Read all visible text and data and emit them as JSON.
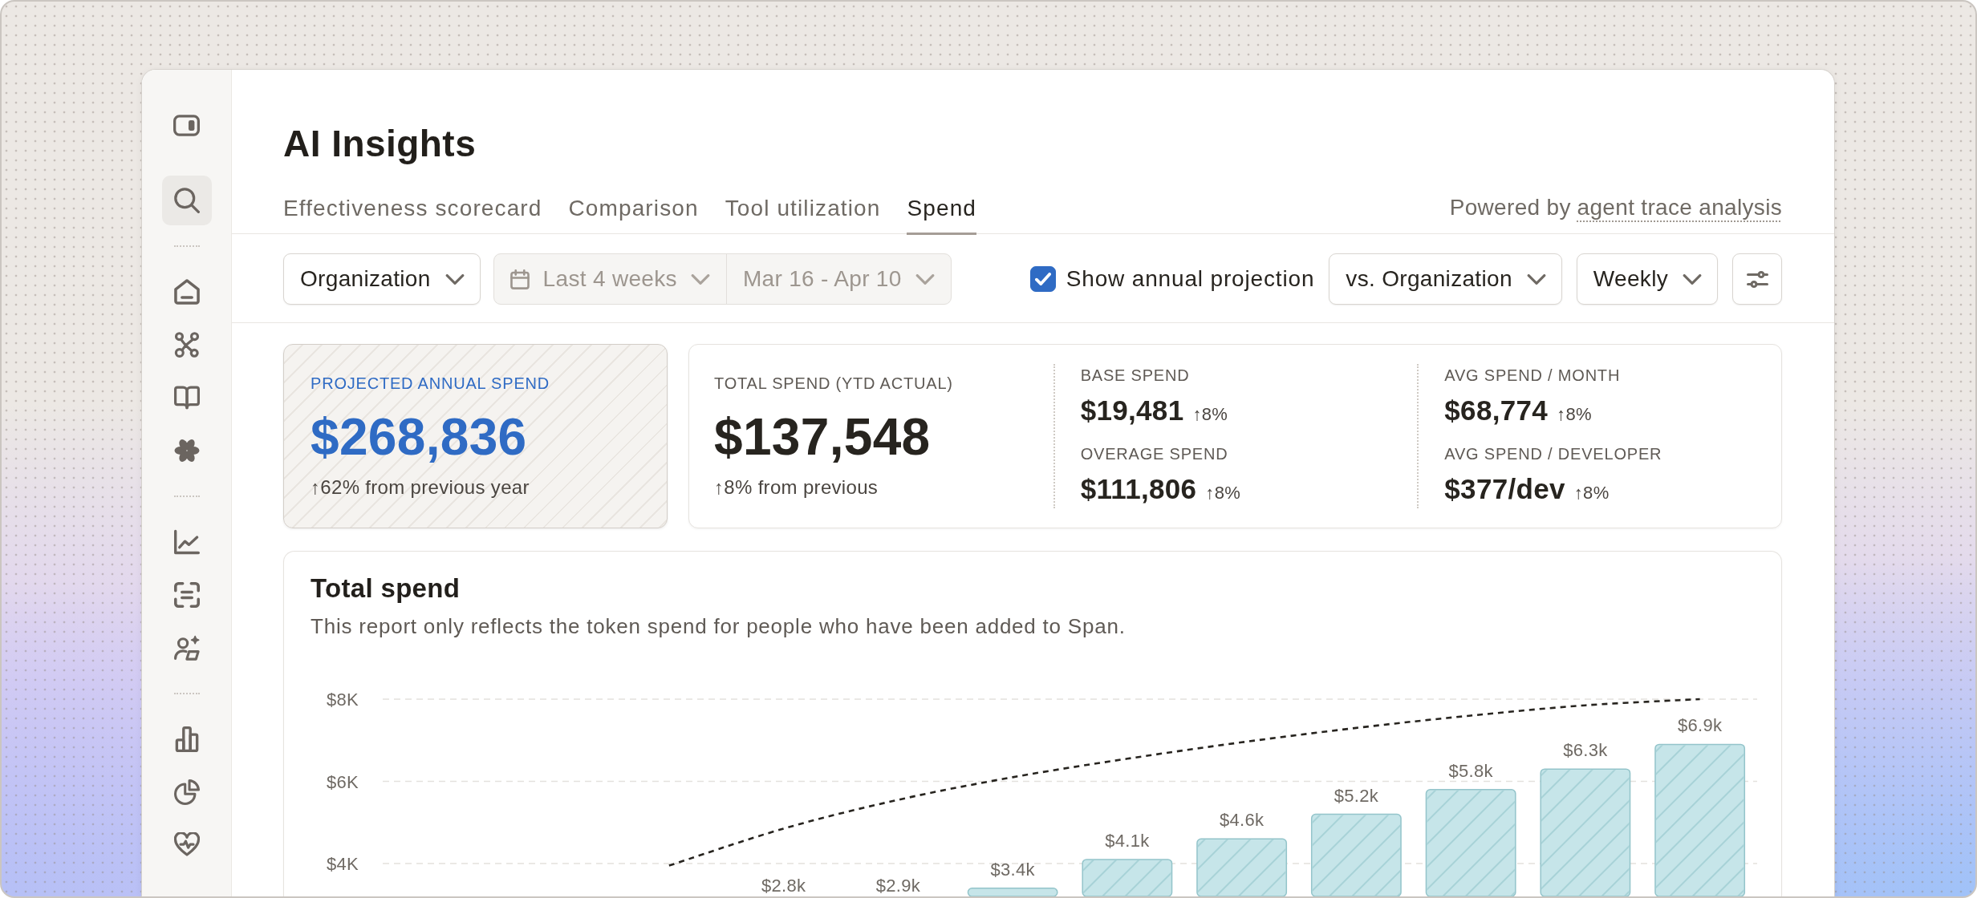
{
  "sidebar": {
    "groups": [
      {
        "items": [
          {
            "selected": true
          }
        ]
      },
      {
        "items": [
          {
            "selected": false
          },
          {
            "selected": false
          },
          {
            "selected": false
          },
          {
            "selected": false
          }
        ]
      },
      {
        "items": [
          {
            "selected": false
          },
          {
            "selected": false
          },
          {
            "selected": false
          }
        ]
      },
      {
        "items": [
          {
            "selected": false
          },
          {
            "selected": false
          },
          {
            "selected": false
          }
        ]
      }
    ]
  },
  "header": {
    "title": "AI Insights",
    "tabs": [
      {
        "label": "Effectiveness scorecard",
        "selected": false
      },
      {
        "label": "Comparison",
        "selected": false
      },
      {
        "label": "Tool utilization",
        "selected": false
      },
      {
        "label": "Spend",
        "selected": true
      }
    ],
    "powered_by": {
      "text": "Powered by",
      "link": "agent trace analysis"
    }
  },
  "toolbar": {
    "scope": {
      "value": "Organization"
    },
    "date_range": {
      "disabled": true,
      "period": "Last 4 weeks",
      "dates": "Mar 16 - Apr 10"
    },
    "projection_toggle": {
      "label": "Show annual projection",
      "checked": true
    },
    "comparison": {
      "value": "vs. Organization"
    },
    "interval": {
      "value": "Weekly"
    }
  },
  "projection_card": {
    "label": "PROJECTED ANNUAL SPEND",
    "value": "$268,836",
    "change": "↑62% from previous year"
  },
  "summary_card": {
    "total": {
      "label": "TOTAL SPEND (YTD ACTUAL)",
      "value": "$137,548",
      "change": "↑8% from previous"
    },
    "metric_columns": [
      {
        "metrics": [
          {
            "label": "BASE SPEND",
            "value": "$19,481",
            "change": "↑8%"
          },
          {
            "label": "OVERAGE SPEND",
            "value": "$111,806",
            "change": "↑8%"
          }
        ]
      },
      {
        "metrics": [
          {
            "label": "AVG SPEND / MONTH",
            "value": "$68,774",
            "change": "↑8%"
          },
          {
            "label": "AVG SPEND / DEVELOPER",
            "value": "$377/dev",
            "change": "↑8%"
          }
        ]
      }
    ]
  },
  "chart_card": {
    "title": "Total spend",
    "subtitle": "This report only reflects the token spend for people who have been added to Span.",
    "chart_data": {
      "type": "bar",
      "ylim": [
        3200,
        8000
      ],
      "yticks": [
        {
          "value": 4000,
          "label": "$4K"
        },
        {
          "value": 6000,
          "label": "$6K"
        },
        {
          "value": 8000,
          "label": "$8K"
        }
      ],
      "series": [
        {
          "type": "bar",
          "color": "#c6e5e9",
          "values": [
            null,
            null,
            null,
            null,
            null,
            3400,
            4100,
            4600,
            5200,
            5800,
            6300,
            6900
          ]
        },
        {
          "type": "line",
          "line_style": "dashed",
          "color": "#27241f",
          "values": [
            null,
            null,
            3950,
            4850,
            5550,
            6100,
            6550,
            6950,
            7300,
            7600,
            7850,
            8000
          ]
        }
      ],
      "value_labels": [
        null,
        null,
        null,
        "$2.8k",
        "$2.9k",
        "$3.4k",
        "$4.1k",
        "$4.6k",
        "$5.2k",
        "$5.8k",
        "$6.3k",
        "$6.9k"
      ]
    }
  }
}
